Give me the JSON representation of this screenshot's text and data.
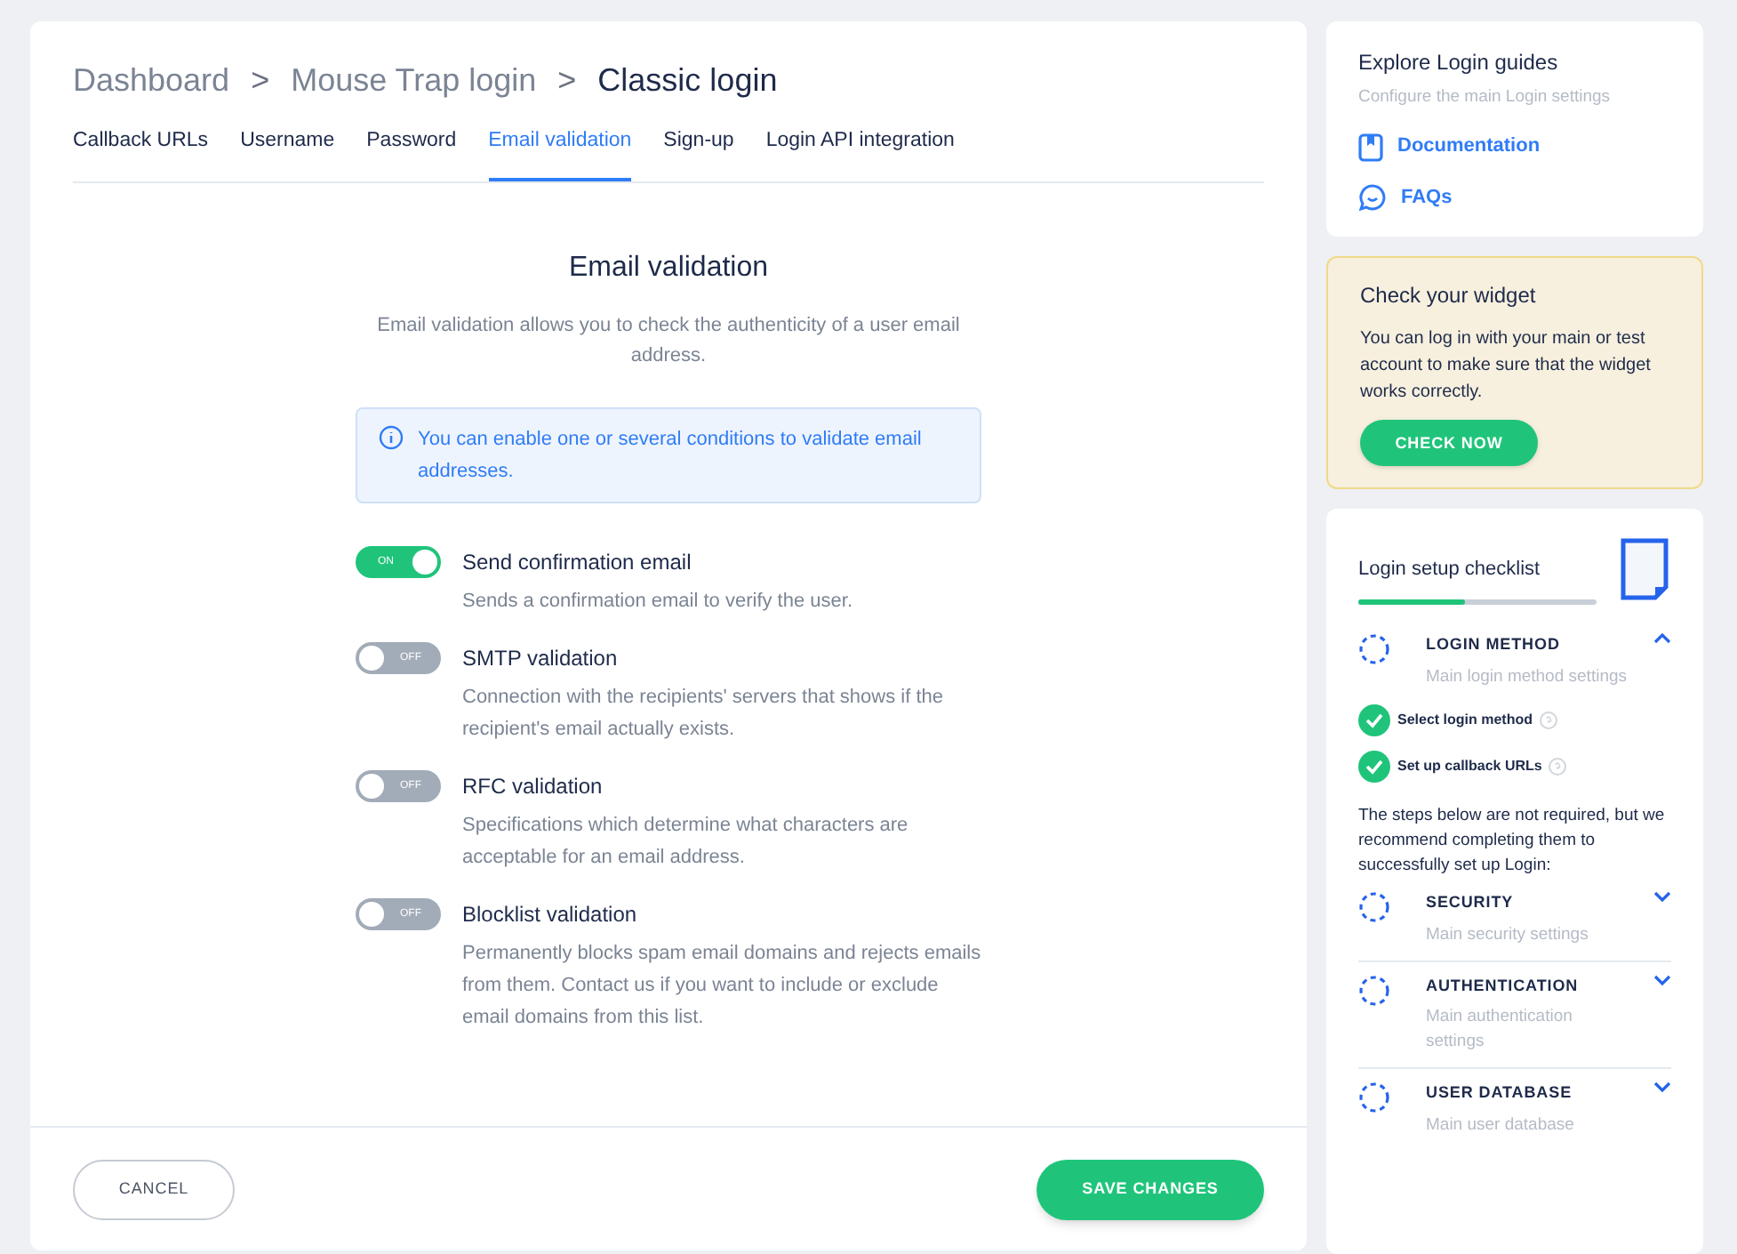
{
  "breadcrumb": [
    {
      "label": "Dashboard",
      "current": false
    },
    {
      "label": "Mouse Trap login",
      "current": false
    },
    {
      "label": "Classic login",
      "current": true
    }
  ],
  "breadcrumb_separator": ">",
  "tabs": [
    {
      "label": "Callback URLs",
      "selected": false
    },
    {
      "label": "Username",
      "selected": false
    },
    {
      "label": "Password",
      "selected": false
    },
    {
      "label": "Email validation",
      "selected": true
    },
    {
      "label": "Sign-up",
      "selected": false
    },
    {
      "label": "Login API integration",
      "selected": false
    }
  ],
  "section": {
    "title": "Email validation",
    "description": "Email validation allows you to check the authenticity of a user email address.",
    "info": "You can enable one or several conditions to validate email addresses."
  },
  "options": [
    {
      "title": "Send confirmation email",
      "description": "Sends a confirmation email to verify the user.",
      "on": true,
      "switch_label": "ON"
    },
    {
      "title": "SMTP validation",
      "description": "Connection with the recipients' servers that shows if the recipient's email actually exists.",
      "on": false,
      "switch_label": "OFF"
    },
    {
      "title": "RFC validation",
      "description": "Specifications which determine what characters are acceptable for an email address.",
      "on": false,
      "switch_label": "OFF"
    },
    {
      "title": "Blocklist validation",
      "description": "Permanently blocks spam email domains and rejects emails from them. Contact us if you want to include or exclude email domains from this list.",
      "on": false,
      "switch_label": "OFF"
    }
  ],
  "footer": {
    "cancel": "CANCEL",
    "save": "SAVE CHANGES"
  },
  "guides": {
    "title": "Explore Login guides",
    "subtitle": "Configure the main Login settings",
    "links": [
      {
        "kind": "book",
        "label": "Documentation"
      },
      {
        "kind": "chat",
        "label": "FAQs"
      }
    ]
  },
  "widget": {
    "title": "Check your widget",
    "text": "You can log in with your main or test account to make sure that the widget works correctly.",
    "button": "CHECK NOW"
  },
  "checklist": {
    "title": "Login setup checklist",
    "level": 0.45,
    "groups": [
      {
        "title": "LOGIN METHOD",
        "subtitle": "Main login method settings",
        "expanded": true,
        "steps": [
          {
            "label": "Select login method",
            "checked": true
          },
          {
            "label": "Set up callback URLs",
            "checked": true
          }
        ]
      }
    ],
    "note": "The steps below are not required, but we recommend completing them to successfully set up Login:",
    "optional": [
      {
        "title": "SECURITY",
        "subtitle": "Main security settings",
        "expanded": false
      },
      {
        "title": "AUTHENTICATION",
        "subtitle": "Main authentication settings",
        "expanded": false
      },
      {
        "title": "USER DATABASE",
        "subtitle": "Main user database",
        "expanded": false
      }
    ]
  }
}
